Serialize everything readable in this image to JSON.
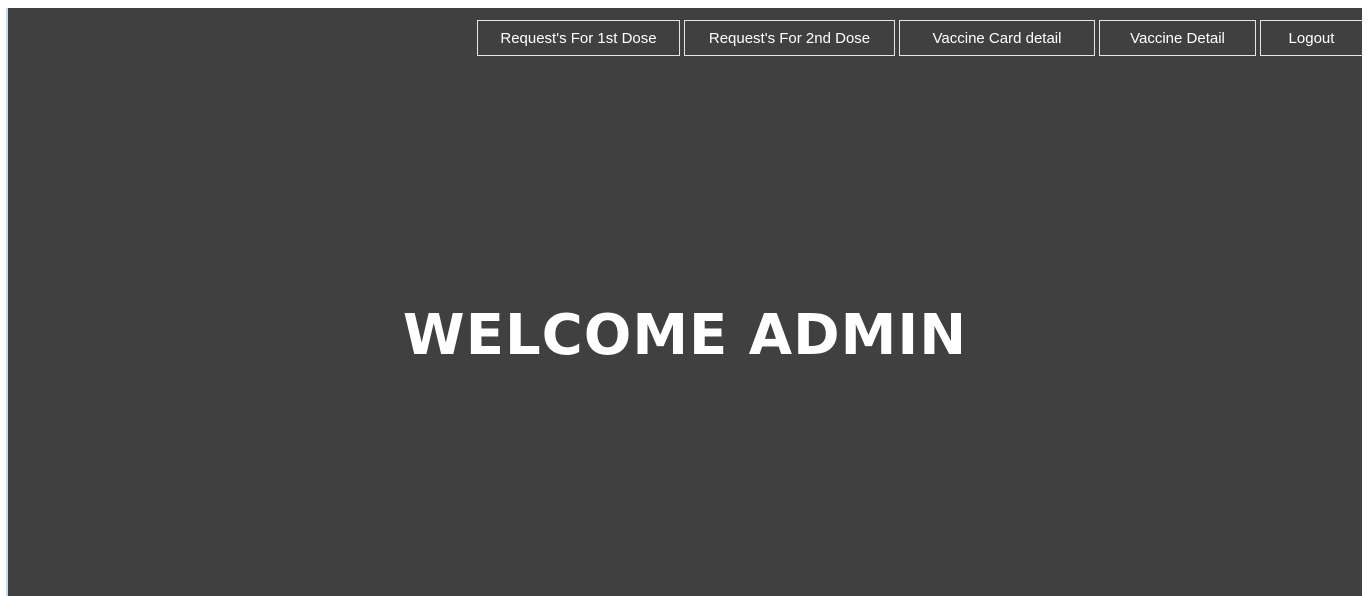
{
  "nav": {
    "items": [
      {
        "label": "Request's For 1st Dose"
      },
      {
        "label": "Request's For 2nd Dose"
      },
      {
        "label": "Vaccine Card detail"
      },
      {
        "label": "Vaccine Detail"
      },
      {
        "label": "Logout"
      }
    ]
  },
  "main": {
    "heading": "WELCOME ADMIN"
  },
  "colors": {
    "background": "#404040",
    "text": "#ffffff",
    "button_border": "#e6e6e6"
  }
}
